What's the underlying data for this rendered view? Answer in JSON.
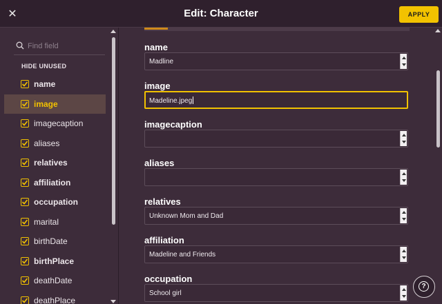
{
  "header": {
    "close_icon": "close-icon",
    "title": "Edit: Character",
    "apply_label": "APPLY"
  },
  "sidebar": {
    "search_placeholder": "Find field",
    "hide_unused_label": "HIDE UNUSED",
    "items": [
      {
        "label": "name",
        "checked": true,
        "used": true
      },
      {
        "label": "image",
        "checked": true,
        "used": true,
        "active": true
      },
      {
        "label": "imagecaption",
        "checked": true,
        "used": false
      },
      {
        "label": "aliases",
        "checked": true,
        "used": false
      },
      {
        "label": "relatives",
        "checked": true,
        "used": true
      },
      {
        "label": "affiliation",
        "checked": true,
        "used": true
      },
      {
        "label": "occupation",
        "checked": true,
        "used": true
      },
      {
        "label": "marital",
        "checked": true,
        "used": false
      },
      {
        "label": "birthDate",
        "checked": true,
        "used": false
      },
      {
        "label": "birthPlace",
        "checked": true,
        "used": true
      },
      {
        "label": "deathDate",
        "checked": true,
        "used": false
      },
      {
        "label": "deathPlace",
        "checked": true,
        "used": false
      }
    ]
  },
  "form": {
    "fields": [
      {
        "name": "name",
        "value": "Madline"
      },
      {
        "name": "image",
        "value": "Madeline.jpeg",
        "focused": true
      },
      {
        "name": "imagecaption",
        "value": ""
      },
      {
        "name": "aliases",
        "value": ""
      },
      {
        "name": "relatives",
        "value": "Unknown Mom and Dad"
      },
      {
        "name": "affiliation",
        "value": "Madeline and Friends"
      },
      {
        "name": "occupation",
        "value": "School girl"
      }
    ]
  },
  "help": {
    "label": "?"
  },
  "colors": {
    "accent": "#f2c200",
    "background": "#3d2c3a",
    "header": "#2f202d",
    "active_row": "#5c4645"
  }
}
